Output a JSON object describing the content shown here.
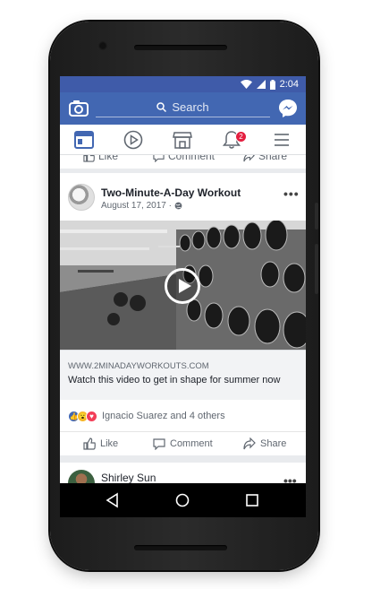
{
  "status_bar": {
    "time": "2:04",
    "icons": [
      "wifi-icon",
      "signal-icon",
      "battery-icon"
    ]
  },
  "header": {
    "search_placeholder": "Search",
    "brand_color": "#4267b2",
    "icons": [
      "camera-icon",
      "search-icon",
      "messenger-icon"
    ]
  },
  "nav_tabs": [
    {
      "name": "news-feed",
      "icon": "news-feed-icon",
      "active": true
    },
    {
      "name": "watch",
      "icon": "play-icon"
    },
    {
      "name": "marketplace",
      "icon": "store-icon"
    },
    {
      "name": "notifications",
      "icon": "bell-icon",
      "badge": "2"
    },
    {
      "name": "menu",
      "icon": "menu-icon"
    }
  ],
  "previous_post": {
    "actions": {
      "like": "Like",
      "comment": "Comment",
      "share": "Share"
    }
  },
  "post": {
    "author": "Two-Minute-A-Day Workout",
    "date": "August 17, 2017 · ",
    "privacy_icon": "globe-icon",
    "more_icon": "more-dots-icon",
    "link_domain": "WWW.2MINADAYWORKOUTS.COM",
    "link_title": "Watch this video to get in shape for summer now",
    "reactions": {
      "types": [
        "like",
        "wow",
        "love"
      ],
      "text": "Ignacio Suarez and 4 others"
    },
    "actions": {
      "like": "Like",
      "comment": "Comment",
      "share": "Share"
    }
  },
  "next_post": {
    "author": "Shirley Sun"
  },
  "android_nav": [
    "back-icon",
    "home-icon",
    "recents-icon"
  ]
}
